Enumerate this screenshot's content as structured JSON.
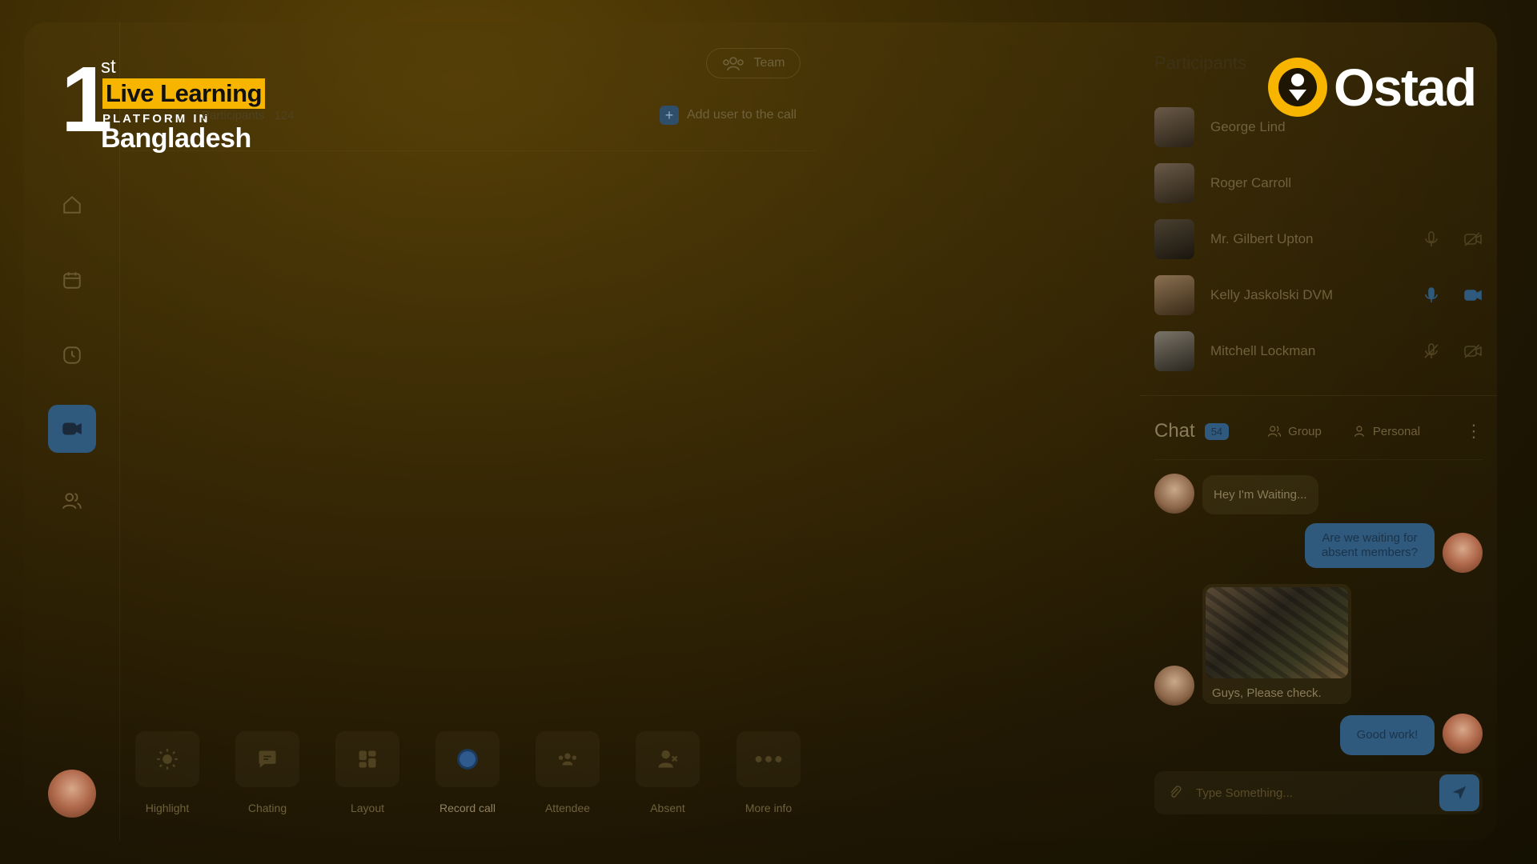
{
  "badge": {
    "number": "1",
    "suffix": "st",
    "highlight": "Live Learning",
    "line2": "PLATFORM IN",
    "line3": "Bangladesh"
  },
  "header": {
    "participants_label": "Participants",
    "participants_count": "124",
    "team_label": "Team",
    "add_user_label": "Add user to the call"
  },
  "sidebar": {
    "items": [
      {
        "icon": "home-icon"
      },
      {
        "icon": "calendar-icon"
      },
      {
        "icon": "history-icon"
      },
      {
        "icon": "video-icon",
        "active": true
      },
      {
        "icon": "users-icon"
      }
    ]
  },
  "toolbar": {
    "items": [
      {
        "label": "Highlight",
        "icon": "sun-icon"
      },
      {
        "label": "Chating",
        "icon": "chat-icon"
      },
      {
        "label": "Layout",
        "icon": "layout-icon"
      },
      {
        "label": "Record call",
        "icon": "record-icon"
      },
      {
        "label": "Attendee",
        "icon": "attendee-icon"
      },
      {
        "label": "Absent",
        "icon": "absent-icon"
      },
      {
        "label": "More info",
        "icon": "more-icon"
      }
    ]
  },
  "brand": {
    "name": "Ostad",
    "accent": "#f7b500"
  },
  "participants": {
    "title": "Participants",
    "list": [
      {
        "name": "George Lind"
      },
      {
        "name": "Roger Carroll"
      },
      {
        "name": "Mr. Gilbert Upton"
      },
      {
        "name": "Kelly Jaskolski DVM"
      },
      {
        "name": "Mitchell Lockman"
      }
    ]
  },
  "chat": {
    "title": "Chat",
    "count": "54",
    "tabs": [
      {
        "label": "Group"
      },
      {
        "label": "Personal"
      }
    ],
    "messages": [
      {
        "from": "other",
        "text": "Hey I'm Waiting..."
      },
      {
        "from": "me",
        "text": "Are we waiting for absent members?"
      },
      {
        "from": "other",
        "text": "Guys, Please check.",
        "has_image": true
      },
      {
        "from": "me",
        "text": "Good work!"
      }
    ],
    "input_placeholder": "Type Something..."
  },
  "colors": {
    "accent_blue": "#2f5a7e",
    "background": "#2a1f04"
  }
}
